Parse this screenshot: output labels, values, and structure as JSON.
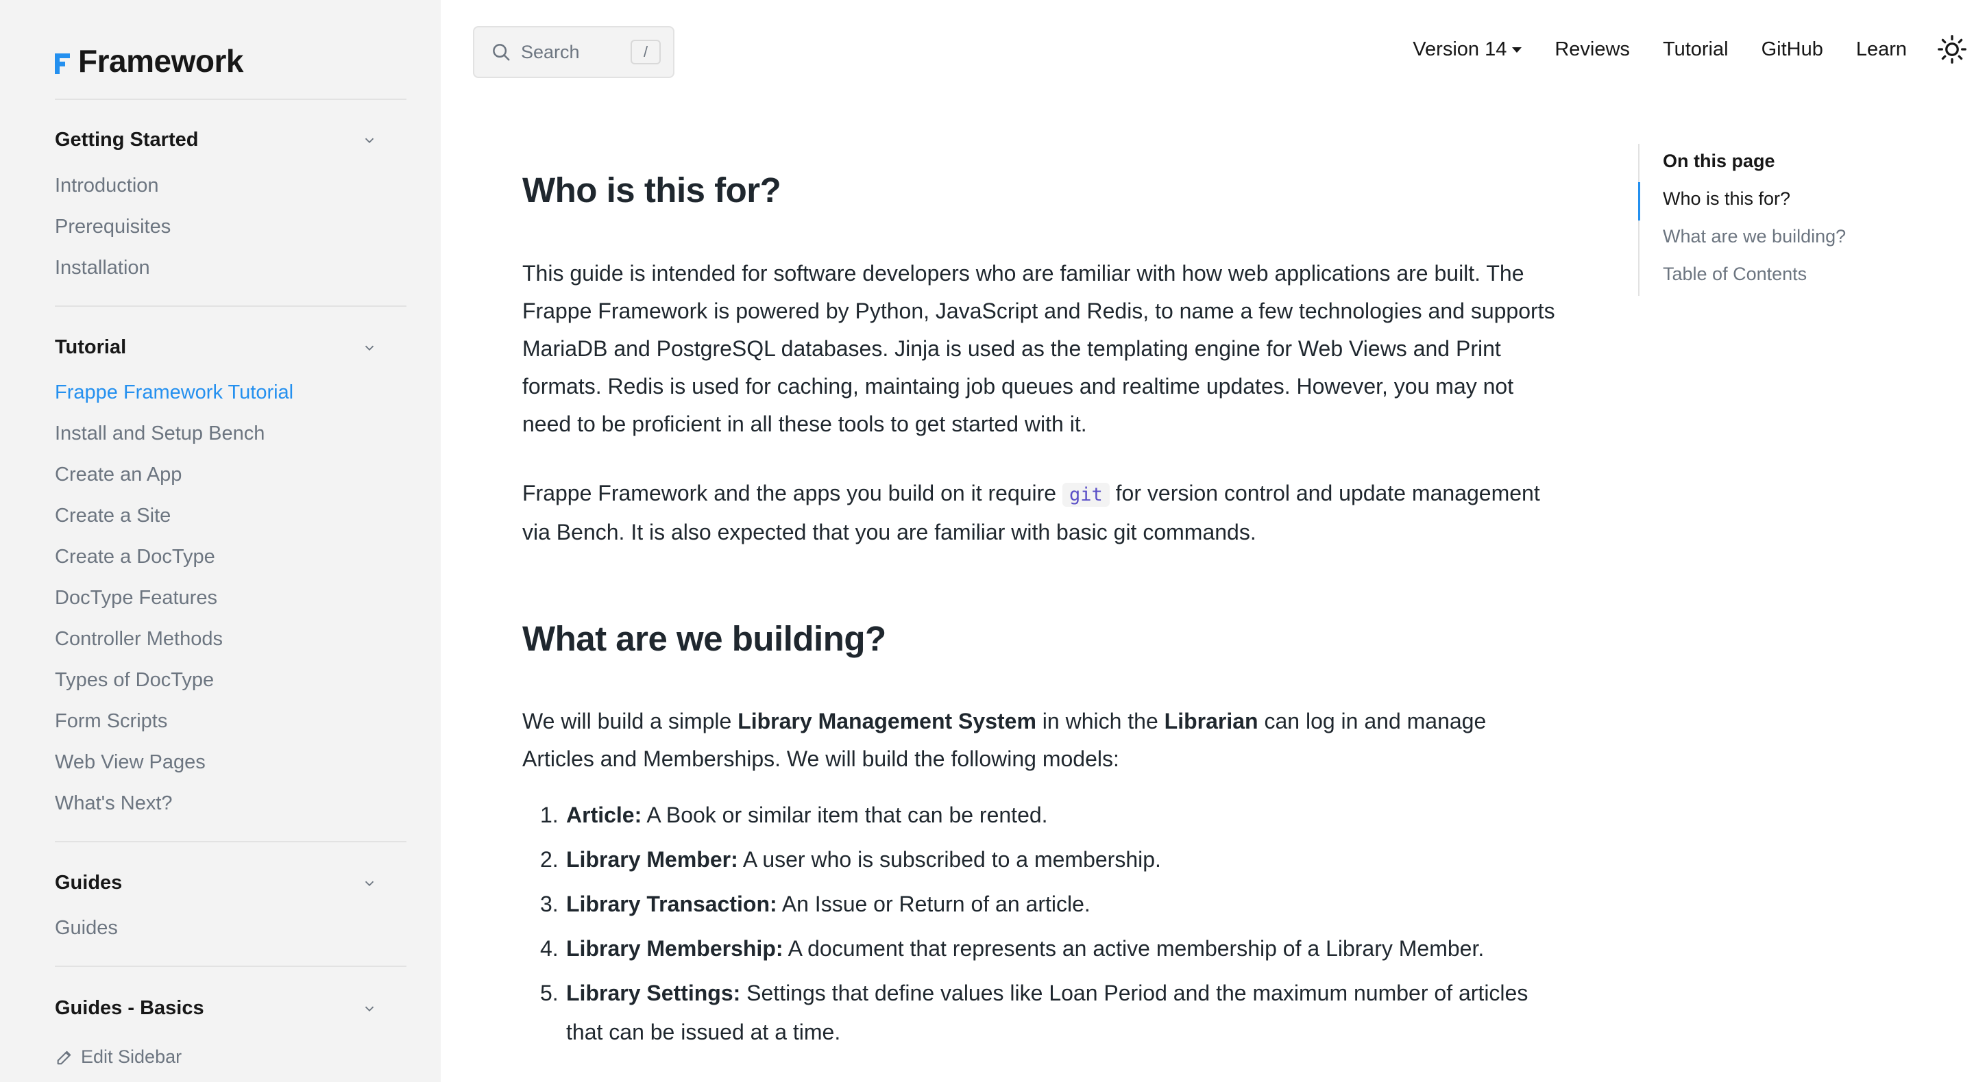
{
  "brand": {
    "name": "Framework"
  },
  "search": {
    "placeholder": "Search",
    "shortcut": "/"
  },
  "topnav": {
    "version": "Version 14",
    "links": [
      "Reviews",
      "Tutorial",
      "GitHub",
      "Learn"
    ]
  },
  "sidebar": {
    "sections": [
      {
        "title": "Getting Started",
        "items": [
          "Introduction",
          "Prerequisites",
          "Installation"
        ]
      },
      {
        "title": "Tutorial",
        "items": [
          "Frappe Framework Tutorial",
          "Install and Setup Bench",
          "Create an App",
          "Create a Site",
          "Create a DocType",
          "DocType Features",
          "Controller Methods",
          "Types of DocType",
          "Form Scripts",
          "Web View Pages",
          "What's Next?"
        ]
      },
      {
        "title": "Guides",
        "items": [
          "Guides"
        ]
      },
      {
        "title": "Guides - Basics",
        "items": []
      }
    ],
    "active_item": "Frappe Framework Tutorial",
    "edit_label": "Edit Sidebar"
  },
  "content": {
    "section1": {
      "title": "Who is this for?",
      "p1": "This guide is intended for software developers who are familiar with how web applications are built. The Frappe Framework is powered by Python, JavaScript and Redis, to name a few technologies and supports MariaDB and PostgreSQL databases. Jinja is used as the templating engine for Web Views and Print formats. Redis is used for caching, maintaing job queues and realtime updates. However, you may not need to be proficient in all these tools to get started with it.",
      "p2_before": "Frappe Framework and the apps you build on it require",
      "p2_code": "git",
      "p2_after": "for version control and update management via Bench. It is also expected that you are familiar with basic git commands."
    },
    "section2": {
      "title": "What are we building?",
      "intro_1": "We will build a simple",
      "intro_bold_1": "Library Management System",
      "intro_2": "in which the",
      "intro_bold_2": "Librarian",
      "intro_3": "can log in and manage Articles and Memberships. We will build the following models:",
      "models": [
        {
          "num": "1.",
          "name": "Article:",
          "desc": "A Book or similar item that can be rented."
        },
        {
          "num": "2.",
          "name": "Library Member:",
          "desc": "A user who is subscribed to a membership."
        },
        {
          "num": "3.",
          "name": "Library Transaction:",
          "desc": "An Issue or Return of an article."
        },
        {
          "num": "4.",
          "name": "Library Membership:",
          "desc": "A document that represents an active membership of a Library Member."
        },
        {
          "num": "5.",
          "name": "Library Settings:",
          "desc": "Settings that define values like Loan Period and the maximum number of articles that can be issued at a time."
        }
      ]
    }
  },
  "toc": {
    "title": "On this page",
    "links": [
      "Who is this for?",
      "What are we building?",
      "Table of Contents"
    ],
    "active": "Who is this for?"
  },
  "colors": {
    "accent": "#2490ef",
    "sidebar_bg": "#f3f3f3",
    "text": "#1f272e",
    "muted": "#6c7580",
    "code": "#5a4fc7"
  }
}
